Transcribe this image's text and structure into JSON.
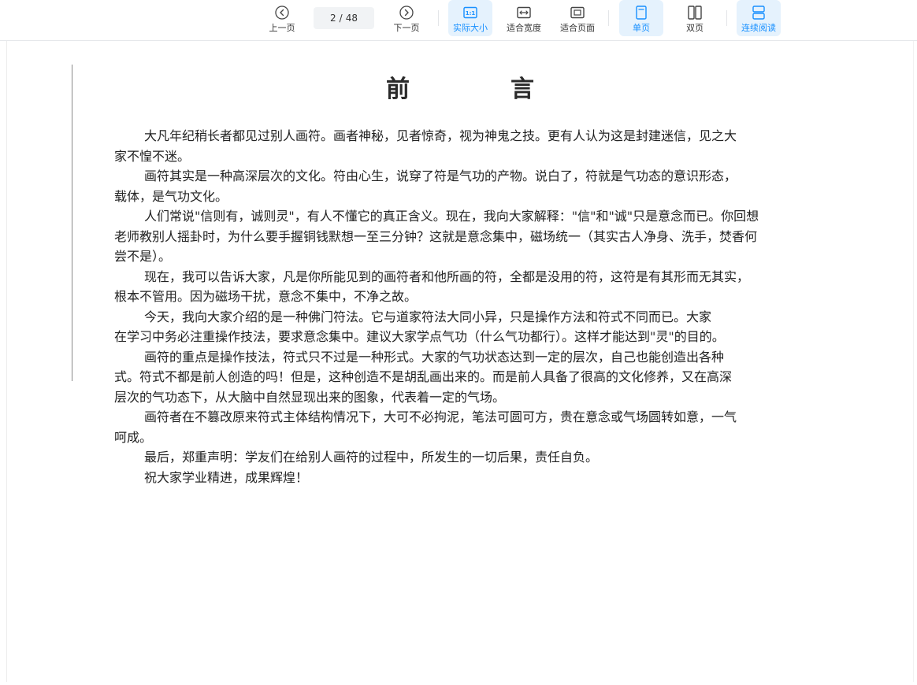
{
  "toolbar": {
    "prev_label": "上一页",
    "next_label": "下一页",
    "current_page": "2",
    "page_separator": "/",
    "total_pages": "48",
    "actual_size_label": "实际大小",
    "fit_width_label": "适合宽度",
    "fit_page_label": "适合页面",
    "single_page_label": "单页",
    "double_page_label": "双页",
    "continuous_label": "连续阅读",
    "accent_color": "#1890ff",
    "active_bg_color": "#e5f2fd",
    "icons": {
      "prev": "chevron-left-circle-icon",
      "next": "chevron-right-circle-icon",
      "actual_size": "one-to-one-icon",
      "fit_width": "fit-width-icon",
      "fit_page": "fit-page-icon",
      "single_page": "single-page-icon",
      "double_page": "double-page-icon",
      "continuous": "continuous-scroll-icon"
    }
  },
  "document": {
    "title": "前言",
    "paragraphs": [
      "大凡年纪稍长者都见过别人画符。画者神秘，见者惊奇，视为神鬼之技。更有人认为这是封建迷信，见之大",
      "家不惶不迷。",
      "画符其实是一种高深层次的文化。符由心生，说穿了符是气功的产物。说白了，符就是气功态的意识形态，",
      "载体，是气功文化。",
      "人们常说\"信则有，诚则灵\"，有人不懂它的真正含义。现在，我向大家解释：\"信\"和\"诚\"只是意念而已。你回想",
      "老师教别人摇卦时，为什么要手握铜钱默想一至三分钟？这就是意念集中，磁场统一（其实古人净身、洗手，焚香何",
      "尝不是）。",
      "现在，我可以告诉大家，凡是你所能见到的画符者和他所画的符，全都是没用的符，这符是有其形而无其实，",
      "根本不管用。因为磁场干扰，意念不集中，不净之故。",
      "今天，我向大家介绍的是一种佛门符法。它与道家符法大同小异，只是操作方法和符式不同而已。大家",
      "在学习中务必注重操作技法，要求意念集中。建议大家学点气功（什么气功都行）。这样才能达到\"灵\"的目的。",
      "画符的重点是操作技法，符式只不过是一种形式。大家的气功状态达到一定的层次，自己也能创造出各种",
      "式。符式不都是前人创造的吗！但是，这种创造不是胡乱画出来的。而是前人具备了很高的文化修养，又在高深",
      "层次的气功态下，从大脑中自然显现出来的图象，代表着一定的气场。",
      "画符者在不篡改原来符式主体结构情况下，大可不必拘泥，笔法可圆可方，贵在意念或气场圆转如意，一气",
      "呵成。",
      "最后，郑重声明：学友们在给别人画符的过程中，所发生的一切后果，责任自负。",
      "祝大家学业精进，成果辉煌！"
    ],
    "indented": [
      true,
      false,
      true,
      false,
      true,
      false,
      false,
      true,
      false,
      true,
      false,
      true,
      false,
      false,
      true,
      false,
      true,
      true
    ]
  }
}
